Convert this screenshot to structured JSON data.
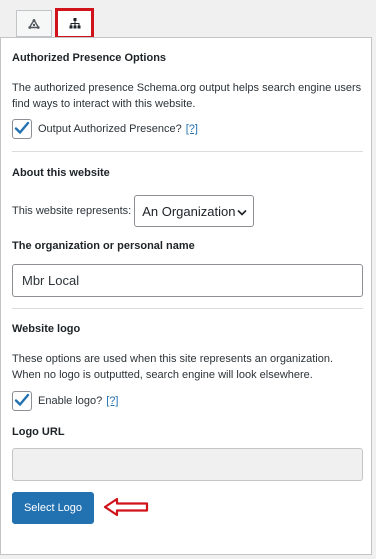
{
  "tabs": [
    {
      "icon": "schema-graph-icon"
    },
    {
      "icon": "sitemap-icon",
      "active": true
    }
  ],
  "authorized_presence": {
    "heading": "Authorized Presence Options",
    "description": "The authorized presence Schema.org output helps search engine users find ways to interact with this website.",
    "checkbox_label": "Output Authorized Presence?",
    "help_link": "[?]",
    "checked": true
  },
  "about": {
    "heading": "About this website",
    "represents_label": "This website represents:",
    "represents_value": "An Organization",
    "name_heading": "The organization or personal name",
    "name_value": "Mbr Local"
  },
  "logo": {
    "heading": "Website logo",
    "description": "These options are used when this site represents an organization. When no logo is outputted, search engine will look elsewhere.",
    "checkbox_label": "Enable logo?",
    "help_link": "[?]",
    "checked": true,
    "url_heading": "Logo URL",
    "url_value": "",
    "select_button": "Select Logo"
  },
  "colors": {
    "accent": "#2271b1",
    "highlight": "#d0121b"
  }
}
